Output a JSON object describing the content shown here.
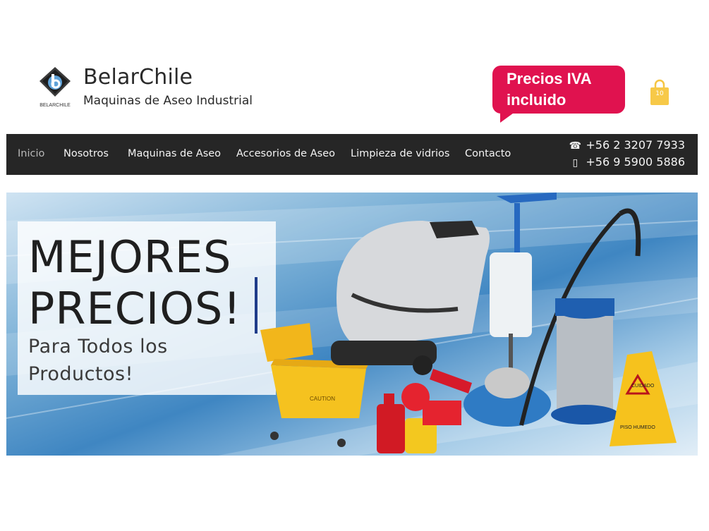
{
  "header": {
    "brand_name": "BelarChile",
    "brand_tagline": "Maquinas de Aseo Industrial",
    "logo_text": "BELARCHILE",
    "iva_line1": "Precios IVA",
    "iva_line2": "incluido",
    "cart_count": "10",
    "accent_color": "#e0124f"
  },
  "nav": {
    "items": [
      {
        "label": "Inicio",
        "active": true
      },
      {
        "label": "Nosotros"
      },
      {
        "label": "Maquinas de Aseo"
      },
      {
        "label": "Accesorios de Aseo"
      },
      {
        "label": "Limpieza de vidrios"
      },
      {
        "label": "Contacto"
      }
    ],
    "phone_landline": "+56 2 3207 7933",
    "phone_mobile": "+56 9 5900 5886"
  },
  "hero": {
    "title_line1": "MEJORES",
    "title_line2": "PRECIOS!",
    "subtitle_line1": "Para Todos los",
    "subtitle_line2": "Productos!",
    "caution_text1": "CAUTION",
    "caution_text2": "CUIDADO",
    "caution_text3": "PISO HUMEDO"
  }
}
